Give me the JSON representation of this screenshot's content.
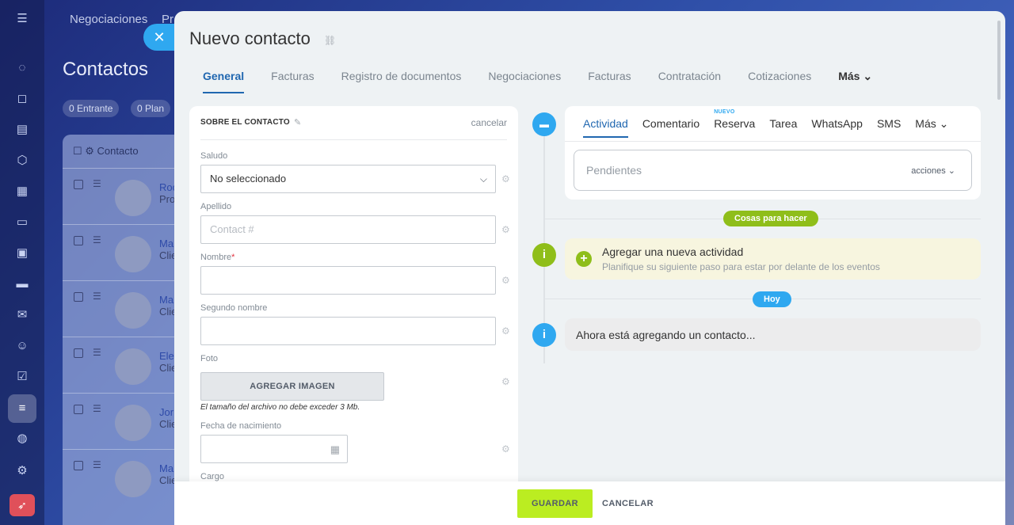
{
  "background": {
    "nav": [
      "Negociaciones",
      "Pr"
    ],
    "nav_badge": "NUEVO",
    "page_title": "Contactos",
    "chips": [
      {
        "count": "0",
        "label": "Entrante"
      },
      {
        "count": "0",
        "label": "Plan"
      }
    ],
    "table_header": "Contacto",
    "rows": [
      {
        "name": "Roc",
        "sub": "Pro"
      },
      {
        "name": "Ma",
        "sub": "Clie"
      },
      {
        "name": "Ma",
        "sub": "Clie"
      },
      {
        "name": "Ele",
        "sub": "Clie"
      },
      {
        "name": "Jor",
        "sub": "Clie"
      },
      {
        "name": "Ma",
        "sub": "Clie"
      }
    ]
  },
  "slider": {
    "title": "Nuevo contacto",
    "tabs": [
      "General",
      "Facturas",
      "Registro de documentos",
      "Negociaciones",
      "Facturas",
      "Contratación",
      "Cotizaciones",
      "Más"
    ],
    "active_tab": "General"
  },
  "form": {
    "section_title": "SOBRE EL CONTACTO",
    "cancel_label": "cancelar",
    "fields": {
      "salutation_label": "Saludo",
      "salutation_value": "No seleccionado",
      "last_name_label": "Apellido",
      "last_name_placeholder": "Contact #",
      "first_name_label": "Nombre",
      "first_name_required": "*",
      "middle_name_label": "Segundo nombre",
      "photo_label": "Foto",
      "add_image_label": "AGREGAR IMAGEN",
      "file_note": "El tamaño del archivo no debe exceder 3 Mb.",
      "birthdate_label": "Fecha de nacimiento",
      "position_label": "Cargo"
    }
  },
  "timeline": {
    "tabs": [
      "Actividad",
      "Comentario",
      "Reserva",
      "Tarea",
      "WhatsApp",
      "SMS",
      "Más"
    ],
    "new_badge": "NUEVO",
    "pending_label": "Pendientes",
    "actions_label": "acciones",
    "todo_pill": "Cosas para hacer",
    "todo_title": "Agregar una nueva actividad",
    "todo_sub": "Planifique su siguiente paso para estar por delante de los eventos",
    "today_pill": "Hoy",
    "now_text": "Ahora está agregando un contacto..."
  },
  "footer": {
    "save_label": "GUARDAR",
    "cancel_label": "CANCELAR"
  },
  "colors": {
    "accent_blue": "#2067b0",
    "save_green": "#bbed21",
    "pill_green": "#8fbe1a",
    "pill_blue": "#2fa8f0"
  }
}
